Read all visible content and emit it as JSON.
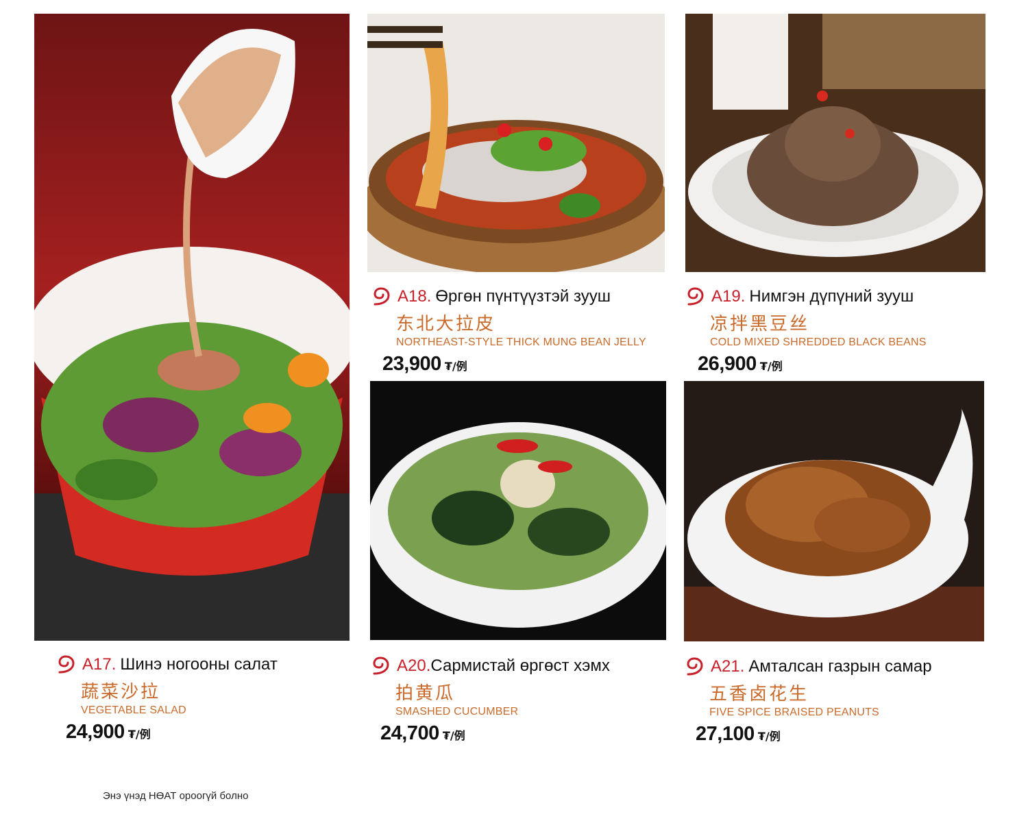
{
  "currency_unit": "₮/例",
  "footnote": "Энэ үнэд НӨАТ ороогүй болно",
  "items": [
    {
      "code": "A17.",
      "name_mn": "Шинэ ногооны салат",
      "name_cn": "蔬菜沙拉",
      "name_en": "VEGETABLE SALAD",
      "price": "24,900",
      "image": "vegetable-salad-photo"
    },
    {
      "code": "A18.",
      "name_mn": "Өргөн пүнтүүзтэй зууш",
      "name_cn": "东北大拉皮",
      "name_en": "NORTHEAST-STYLE THICK MUNG BEAN JELLY",
      "price": "23,900",
      "image": "mung-bean-jelly-photo"
    },
    {
      "code": "A19.",
      "name_mn": "Нимгэн дүпүний зууш",
      "name_cn": "凉拌黑豆丝",
      "name_en": "COLD MIXED SHREDDED BLACK BEANS",
      "price": "26,900",
      "image": "black-bean-noodles-photo"
    },
    {
      "code": "A20.",
      "name_mn": "Сармистай өргөст хэмх",
      "name_cn": "拍黄瓜",
      "name_en": "SMASHED CUCUMBER",
      "price": "24,700",
      "image": "smashed-cucumber-photo"
    },
    {
      "code": "A21.",
      "name_mn": "Амталсан газрын самар",
      "name_cn": "五香卤花生",
      "name_en": "FIVE SPICE BRAISED PEANUTS",
      "price": "27,100",
      "image": "braised-peanuts-photo"
    }
  ],
  "colors": {
    "accent_red": "#c8202a",
    "accent_orange": "#c96a2b",
    "text": "#111111"
  }
}
